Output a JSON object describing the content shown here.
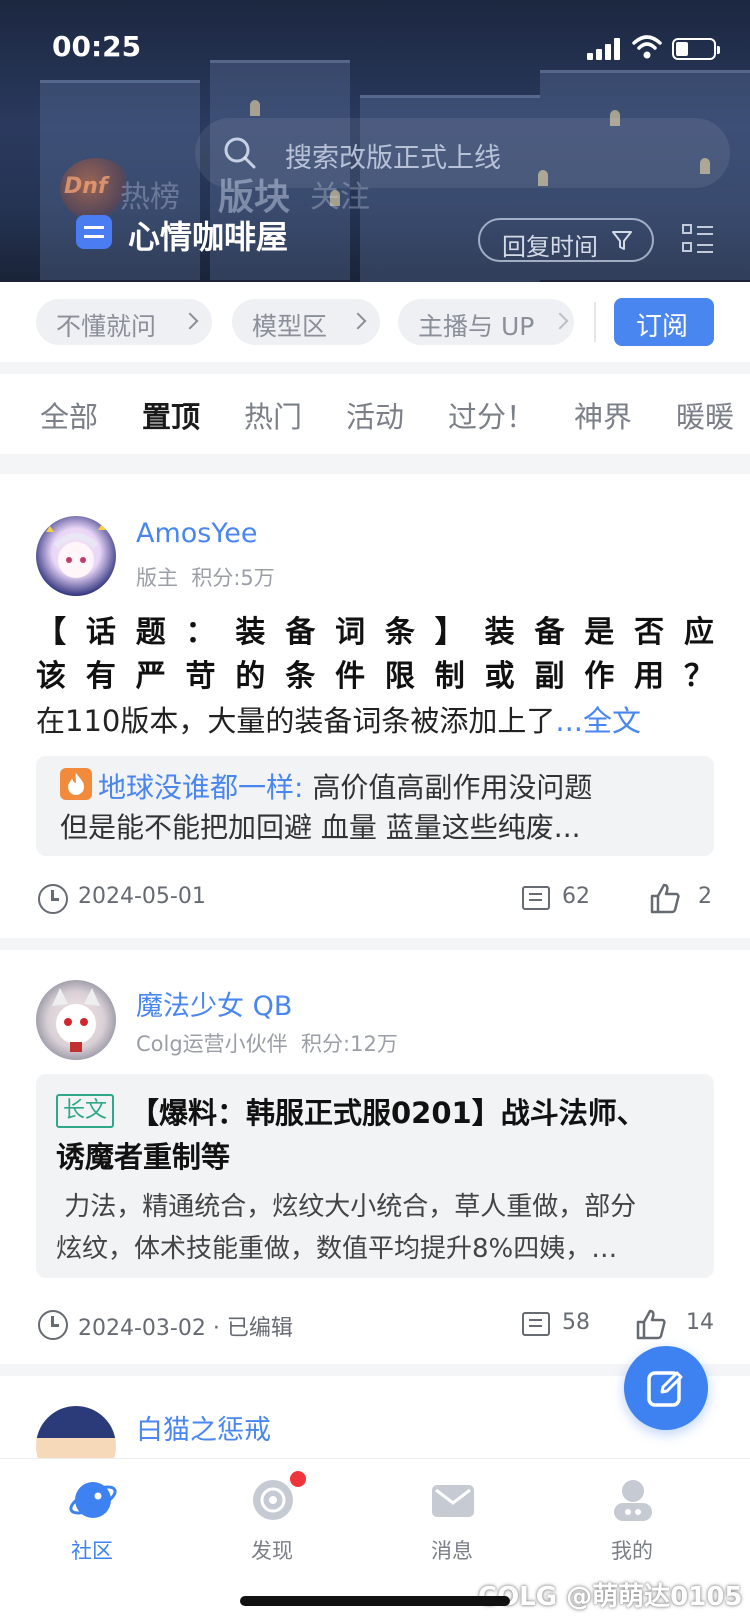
{
  "status_bar": {
    "time": "00:25"
  },
  "search": {
    "placeholder": "搜索改版正式上线"
  },
  "header_tabs": [
    "热榜",
    "版块",
    "关注"
  ],
  "board": {
    "name": "心情咖啡屋",
    "sort_label": "回复时间"
  },
  "chips": [
    {
      "label": "不懂就问"
    },
    {
      "label": "模型区"
    },
    {
      "label": "主播与 UP"
    }
  ],
  "subscribe_label": "订阅",
  "categories": [
    "全部",
    "置顶",
    "热门",
    "活动",
    "过分！",
    "神界",
    "暖暖"
  ],
  "active_category": "置顶",
  "posts": [
    {
      "author": "AmosYee",
      "role": "版主",
      "points": "积分:5万",
      "title_line1": "【话题：装备词条】装备是否应",
      "title_line2": "该有严苛的条件限制或副作用？",
      "excerpt": "在110版本，大量的装备词条被添加上了",
      "more": "...全文",
      "hot_comment_user": "地球没谁都一样:",
      "hot_comment_text1": "高价值高副作用没问题",
      "hot_comment_text2": "但是能不能把加回避 血量 蓝量这些纯废...",
      "date": "2024-05-01",
      "comments": "62",
      "likes": "2"
    },
    {
      "author": "魔法少女 QB",
      "role": "Colg运营小伙伴",
      "points": "积分:12万",
      "tag": "长文",
      "title_line1": "【爆料：韩服正式服0201】战斗法师、",
      "title_line2": "诱魔者重制等",
      "summary_line1": " 力法，精通统合，炫纹大小统合，草人重做，部分",
      "summary_line2": "炫纹，体术技能重做，数值平均提升8%四姨，…",
      "date": "2024-03-02",
      "edited": "· 已编辑",
      "comments": "58",
      "likes": "14"
    },
    {
      "author": "白猫之惩戒"
    }
  ],
  "bottom_nav": [
    {
      "label": "社区",
      "icon": "planet-icon"
    },
    {
      "label": "发现",
      "icon": "discover-icon"
    },
    {
      "label": "消息",
      "icon": "mail-icon"
    },
    {
      "label": "我的",
      "icon": "profile-icon"
    }
  ],
  "watermark": "COLG @萌萌达0105",
  "colors": {
    "accent": "#4a86f0",
    "fab": "#3d82f0",
    "badge_red": "#f0343c"
  }
}
